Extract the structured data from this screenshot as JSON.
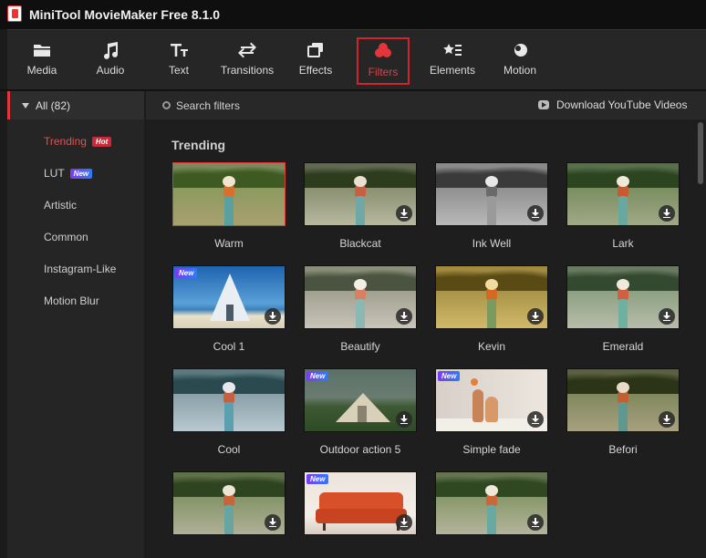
{
  "app": {
    "title": "MiniTool MovieMaker Free 8.1.0"
  },
  "toolbar": [
    {
      "label": "Media",
      "icon": "folder-icon"
    },
    {
      "label": "Audio",
      "icon": "music-note-icon"
    },
    {
      "label": "Text",
      "icon": "text-icon"
    },
    {
      "label": "Transitions",
      "icon": "transition-arrows-icon"
    },
    {
      "label": "Effects",
      "icon": "effects-icon"
    },
    {
      "label": "Filters",
      "icon": "filters-icon",
      "active": true
    },
    {
      "label": "Elements",
      "icon": "elements-icon"
    },
    {
      "label": "Motion",
      "icon": "motion-icon"
    }
  ],
  "sidebar": {
    "all_label": "All (82)",
    "items": [
      {
        "label": "Trending",
        "badge": "Hot",
        "active": true
      },
      {
        "label": "LUT",
        "badge": "New"
      },
      {
        "label": "Artistic"
      },
      {
        "label": "Common"
      },
      {
        "label": "Instagram-Like"
      },
      {
        "label": "Motion Blur"
      }
    ]
  },
  "search": {
    "label": "Search filters"
  },
  "download": {
    "label": "Download YouTube Videos"
  },
  "section": {
    "title": "Trending"
  },
  "filters": [
    {
      "name": "Warm",
      "scene": "field",
      "tone": "warm",
      "selected": true,
      "download": false,
      "is_new": false
    },
    {
      "name": "Blackcat",
      "scene": "field",
      "tone": "blackcat",
      "download": true,
      "is_new": false
    },
    {
      "name": "Ink Well",
      "scene": "field",
      "tone": "bw",
      "download": true,
      "is_new": false
    },
    {
      "name": "Lark",
      "scene": "field",
      "tone": "lark",
      "download": true,
      "is_new": false
    },
    {
      "name": "Cool 1",
      "scene": "tent-sea",
      "tone": "cool",
      "download": true,
      "is_new": true
    },
    {
      "name": "Beautify",
      "scene": "field",
      "tone": "beautify",
      "download": true,
      "is_new": false
    },
    {
      "name": "Kevin",
      "scene": "field",
      "tone": "kevin",
      "download": true,
      "is_new": false
    },
    {
      "name": "Emerald",
      "scene": "field",
      "tone": "emerald",
      "download": true,
      "is_new": false
    },
    {
      "name": "Cool",
      "scene": "field",
      "tone": "coolblue",
      "download": false,
      "is_new": false
    },
    {
      "name": "Outdoor action 5",
      "scene": "tent",
      "tone": "outdoor",
      "download": true,
      "is_new": true
    },
    {
      "name": "Simple fade",
      "scene": "vase",
      "tone": "fade",
      "download": true,
      "is_new": true
    },
    {
      "name": "Befori",
      "scene": "field",
      "tone": "befori",
      "download": true,
      "is_new": false
    },
    {
      "name": "",
      "scene": "field",
      "tone": "plain",
      "download": true,
      "is_new": false
    },
    {
      "name": "",
      "scene": "sofa",
      "tone": "sofa",
      "download": true,
      "is_new": true
    },
    {
      "name": "",
      "scene": "field",
      "tone": "plain2",
      "download": true,
      "is_new": false
    }
  ],
  "colors": {
    "accent": "#e2363a",
    "background": "#1e1e1e",
    "panel": "#252525"
  }
}
